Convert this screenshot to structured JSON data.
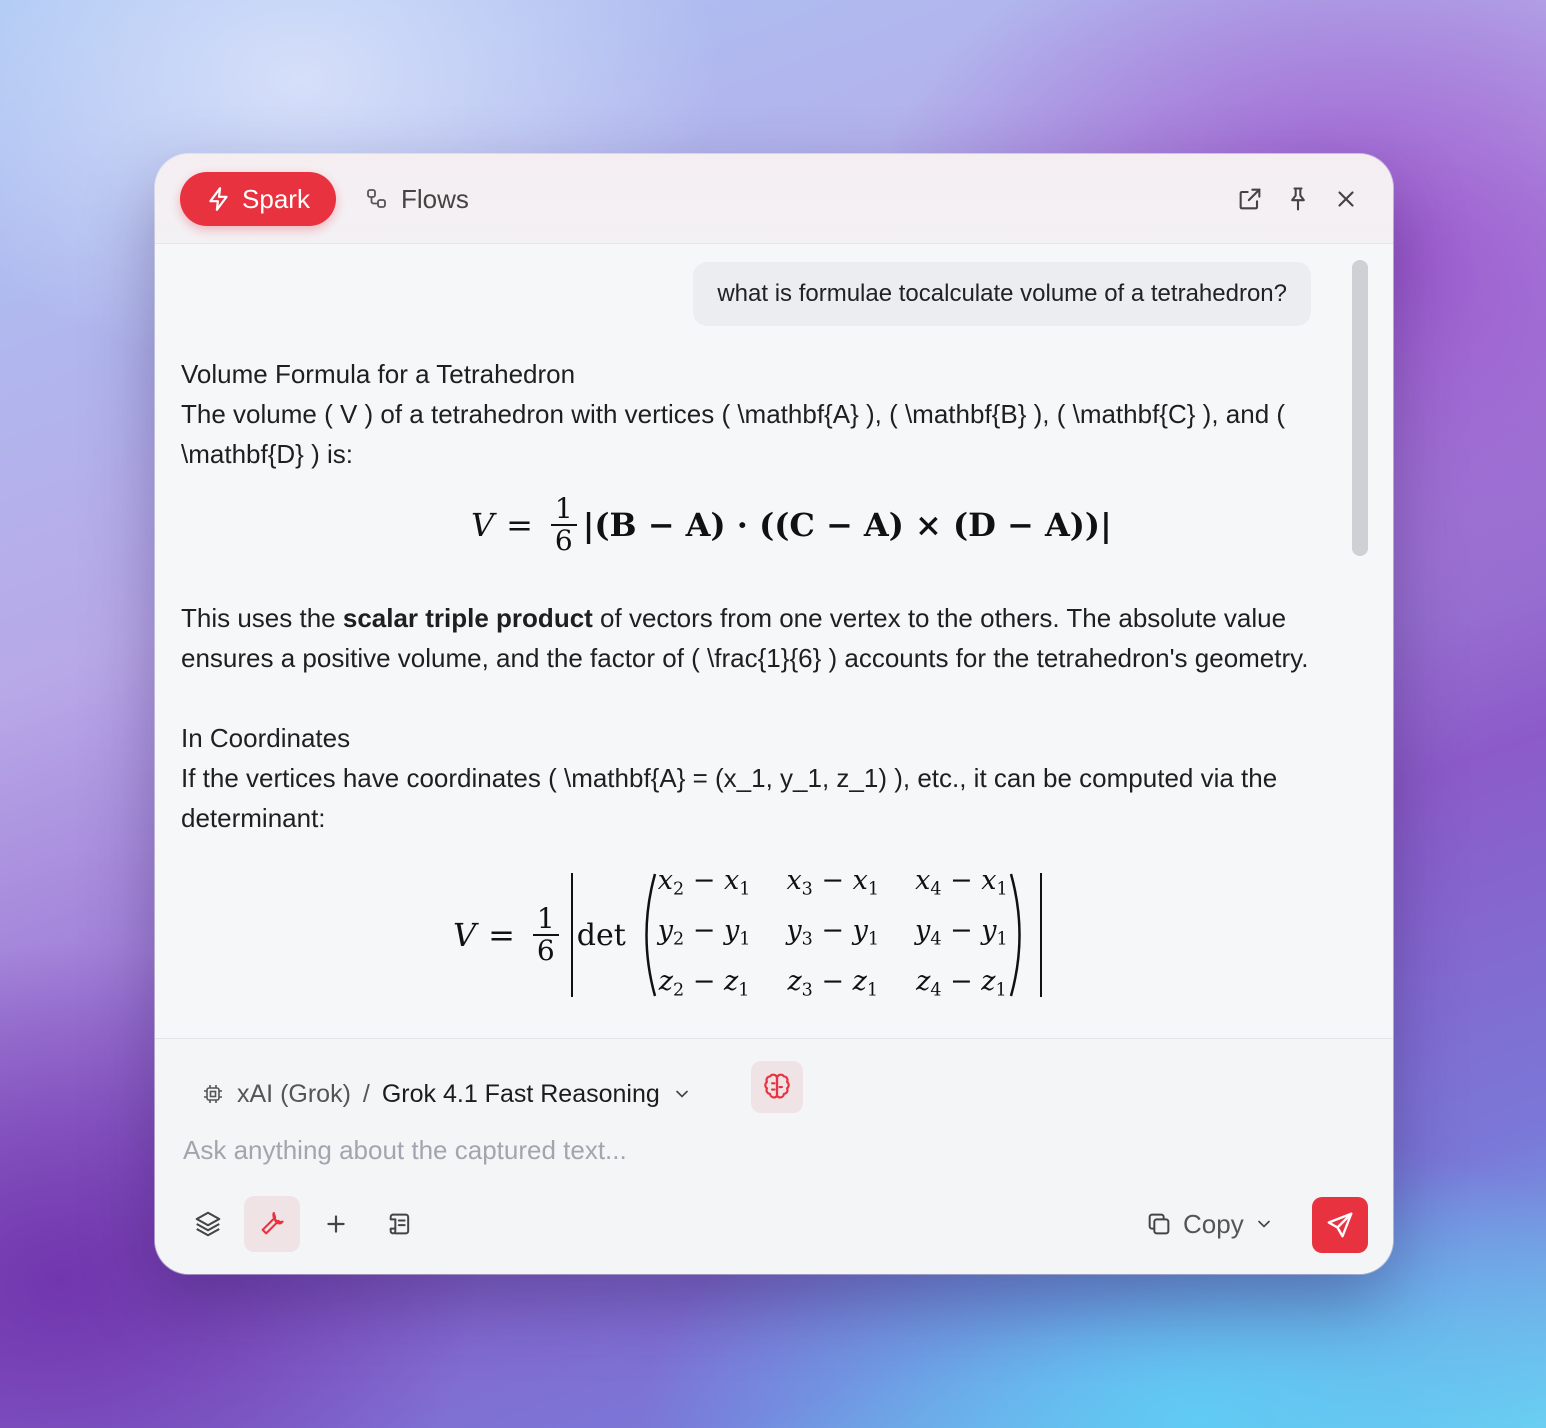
{
  "header": {
    "tabs": [
      {
        "label": "Spark",
        "active": true
      },
      {
        "label": "Flows",
        "active": false
      }
    ]
  },
  "chat": {
    "user_message": "what is formulae tocalculate volume of a tetrahedron?",
    "response": {
      "heading": "Volume Formula for a Tetrahedron",
      "intro": "The volume ( V ) of a tetrahedron with vertices ( \\mathbf{A} ), ( \\mathbf{B} ), ( \\mathbf{C} ), and ( \\mathbf{D} ) is:",
      "formula1": {
        "lhs": "V",
        "eq": "=",
        "frac_num": "1",
        "frac_den": "6",
        "body": "|(B − A) · ((C − A) × (D − A))|"
      },
      "explain_prefix": "This uses the ",
      "explain_bold": "scalar triple product",
      "explain_suffix": " of vectors from one vertex to the others. The absolute value ensures a positive volume, and the factor of ( \\frac{1}{6} ) accounts for the tetrahedron's geometry.",
      "subheading": "In Coordinates",
      "coord_text": "If the vertices have coordinates ( \\mathbf{A} = (x_1, y_1, z_1) ), etc., it can be computed via the determinant:",
      "formula2": {
        "lhs": "V",
        "eq": "=",
        "frac_num": "1",
        "frac_den": "6",
        "det": "det",
        "matrix": [
          [
            "x",
            "2",
            "x",
            "1"
          ],
          [
            "x",
            "3",
            "x",
            "1"
          ],
          [
            "x",
            "4",
            "x",
            "1"
          ],
          [
            "y",
            "2",
            "y",
            "1"
          ],
          [
            "y",
            "3",
            "y",
            "1"
          ],
          [
            "y",
            "4",
            "y",
            "1"
          ],
          [
            "z",
            "2",
            "z",
            "1"
          ],
          [
            "z",
            "3",
            "z",
            "1"
          ],
          [
            "z",
            "4",
            "z",
            "1"
          ]
        ]
      }
    }
  },
  "footer": {
    "provider": "xAI (Grok)",
    "separator": "/",
    "model": "Grok 4.1 Fast Reasoning",
    "input_placeholder": "Ask anything about the captured text...",
    "input_value": "",
    "copy_label": "Copy"
  },
  "colors": {
    "accent": "#e8323f"
  }
}
